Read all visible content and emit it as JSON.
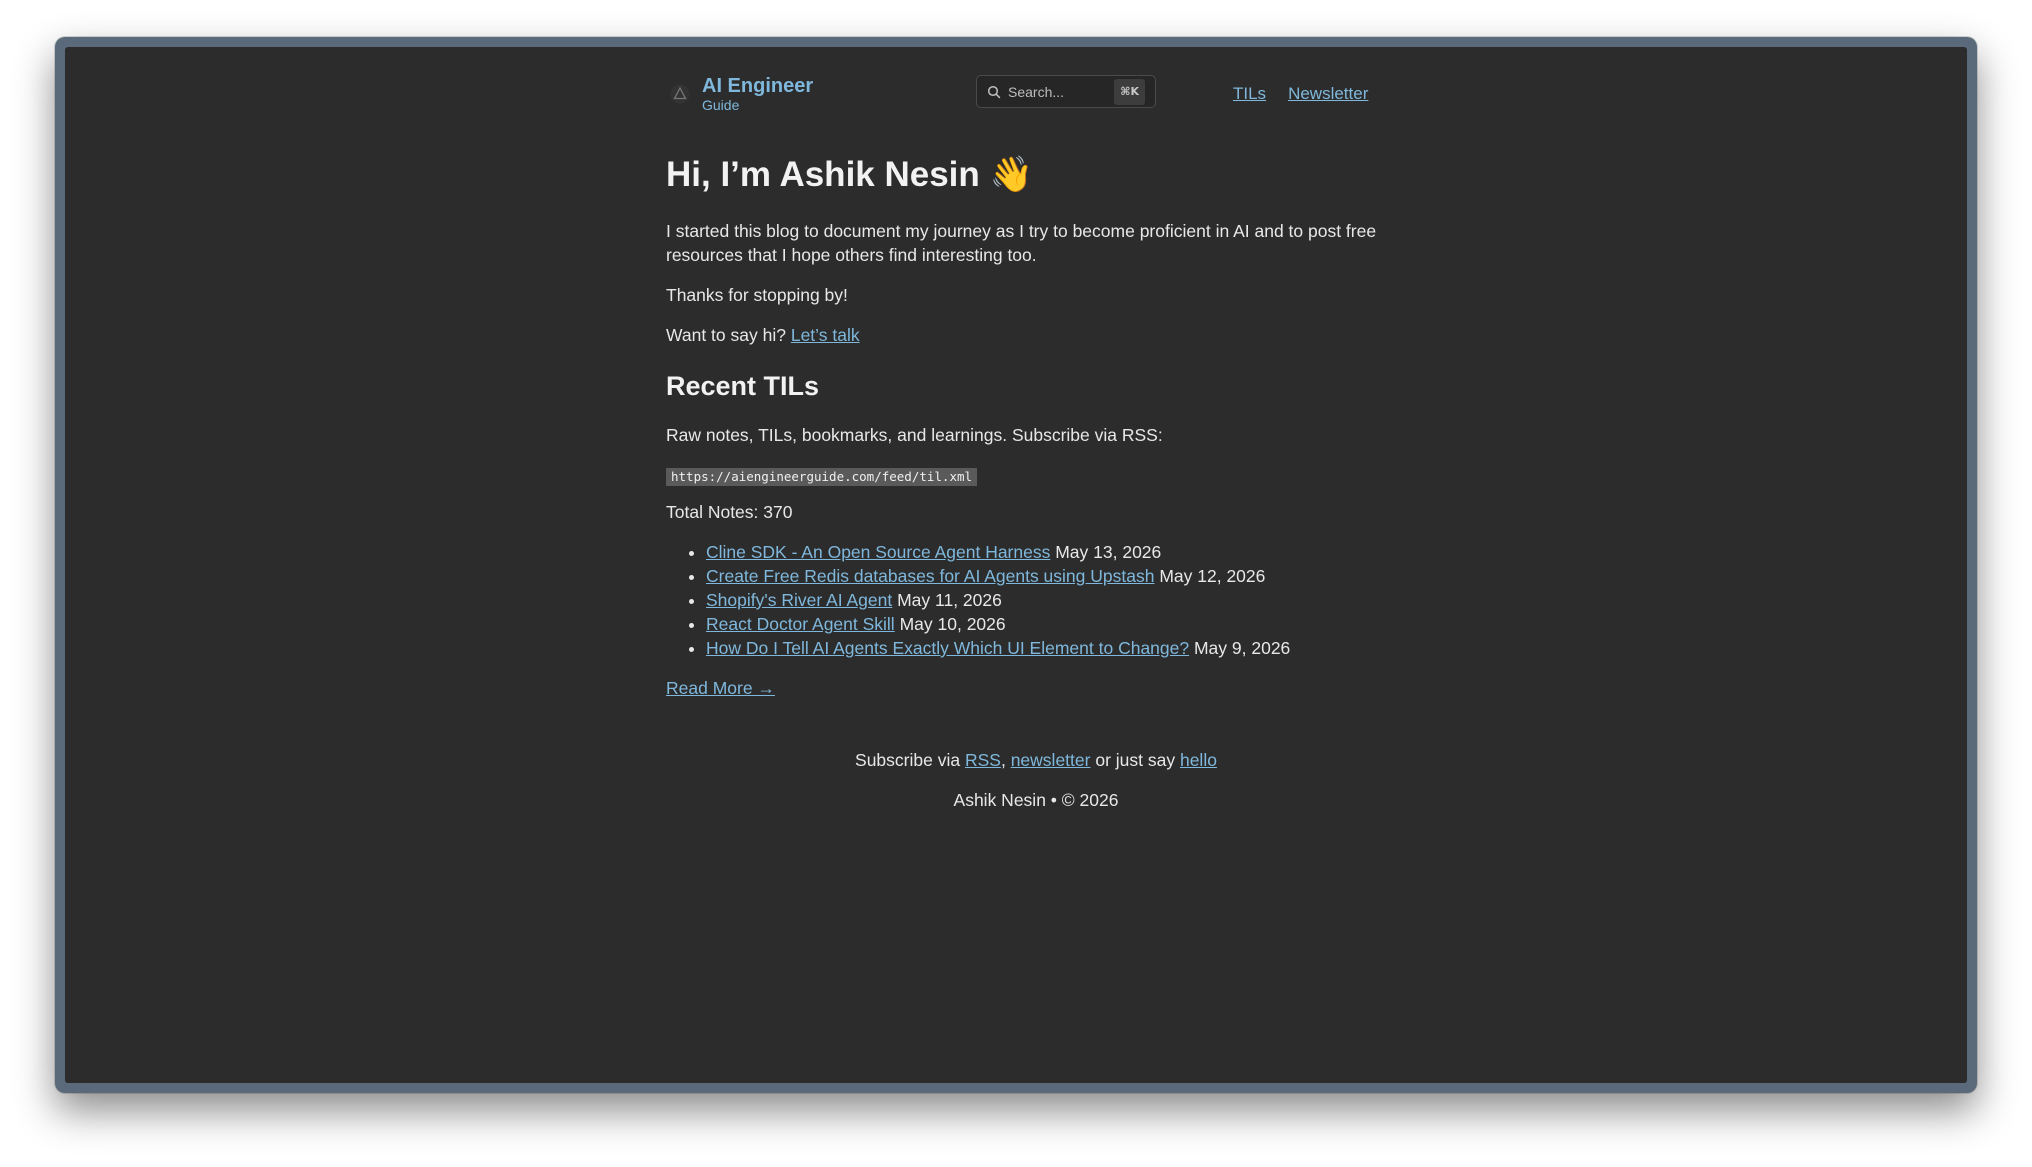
{
  "site": {
    "logo_title": "AI Engineer",
    "logo_subtitle": "Guide"
  },
  "search": {
    "placeholder": "Search...",
    "shortcut": "⌘K"
  },
  "nav": {
    "items": [
      {
        "label": "TILs"
      },
      {
        "label": "Newsletter"
      }
    ]
  },
  "hero": {
    "title": "Hi, I’m Ashik Nesin 👋",
    "intro": "I started this blog to document my journey as I try to become proficient in AI and to post free resources that I hope others find interesting too.",
    "thanks": "Thanks for stopping by!",
    "say_hi_prefix": "Want to say hi?",
    "say_hi_link": "Let’s talk"
  },
  "recent_tils": {
    "heading": "Recent TILs",
    "description": "Raw notes, TILs, bookmarks, and learnings. Subscribe via RSS:",
    "rss_url": "https://aiengineerguide.com/feed/til.xml",
    "total_notes": "Total Notes: 370",
    "items": [
      {
        "title": "Cline SDK - An Open Source Agent Harness",
        "date": "May 13, 2026"
      },
      {
        "title": "Create Free Redis databases for AI Agents using Upstash",
        "date": "May 12, 2026"
      },
      {
        "title": "Shopify's River AI Agent",
        "date": "May 11, 2026"
      },
      {
        "title": "React Doctor Agent Skill",
        "date": "May 10, 2026"
      },
      {
        "title": "How Do I Tell AI Agents Exactly Which UI Element to Change?",
        "date": "May 9, 2026"
      }
    ],
    "read_more": "Read More →"
  },
  "footer": {
    "subscribe_prefix": "Subscribe via",
    "rss_link": "RSS",
    "comma": ",",
    "newsletter_link": "newsletter",
    "or_say": "or just say",
    "hello_link": "hello",
    "copyright": "Ashik Nesin • © 2026"
  },
  "colors": {
    "background": "#2c2c2c",
    "link": "#7fb8dc",
    "text": "#e8e8e8"
  }
}
